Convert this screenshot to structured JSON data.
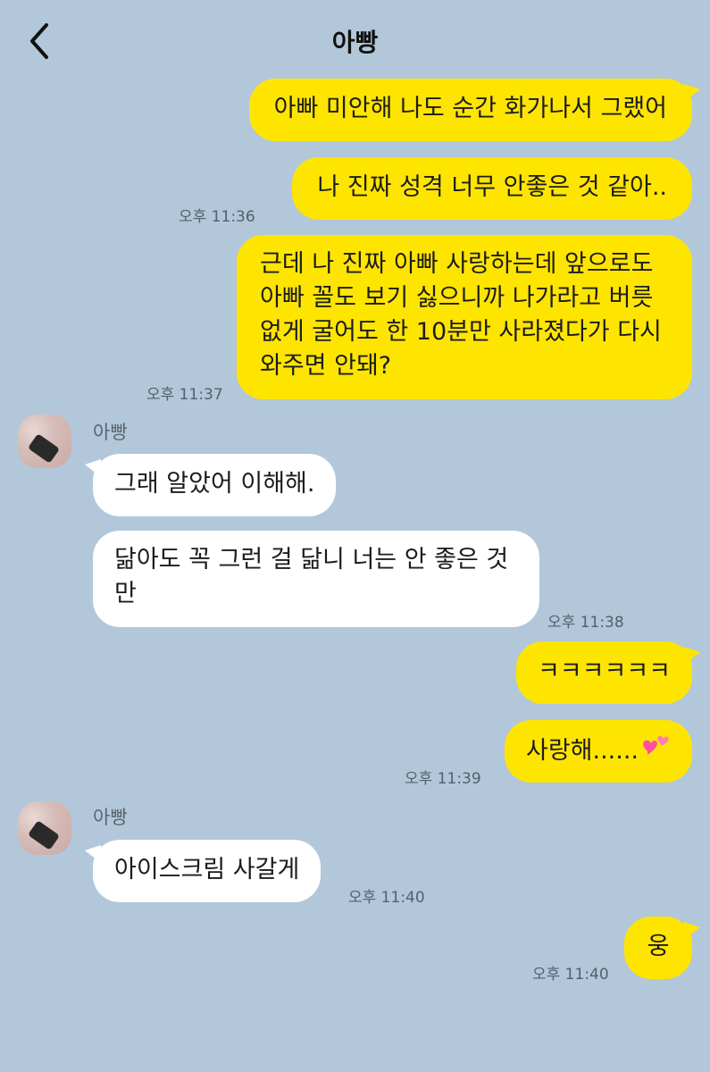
{
  "header": {
    "title": "아빵",
    "back_icon": "chevron-left-icon"
  },
  "messages": {
    "m1": "아빠 미안해 나도 순간 화가나서 그랬어",
    "m2": "나 진짜 성격 너무 안좋은 것 같아..",
    "t2": "오후 11:36",
    "m3": "근데 나 진짜 아빠 사랑하는데 앞으로도 아빠 꼴도 보기 싫으니까 나가라고 버릇 없게 굴어도 한 10분만 사라졌다가 다시 와주면 안돼?",
    "t3": "오후 11:37",
    "sender1": "아빵",
    "m4": "그래 알았어 이해해.",
    "m5": "닮아도 꼭 그런 걸 닮니 너는 안 좋은 것만",
    "t5": "오후 11:38",
    "m6": "ㅋㅋㅋㅋㅋㅋ",
    "m7": "사랑해......",
    "t7": "오후 11:39",
    "sender2": "아빵",
    "m8": "아이스크림 사갈게",
    "t8": "오후 11:40",
    "m9": "웅",
    "t9": "오후 11:40"
  },
  "colors": {
    "background": "#b2c7da",
    "my_bubble": "#fee500",
    "their_bubble": "#ffffff"
  },
  "icons": {
    "heart_emoji": "two-hearts-icon",
    "avatar": "profile-avatar"
  }
}
